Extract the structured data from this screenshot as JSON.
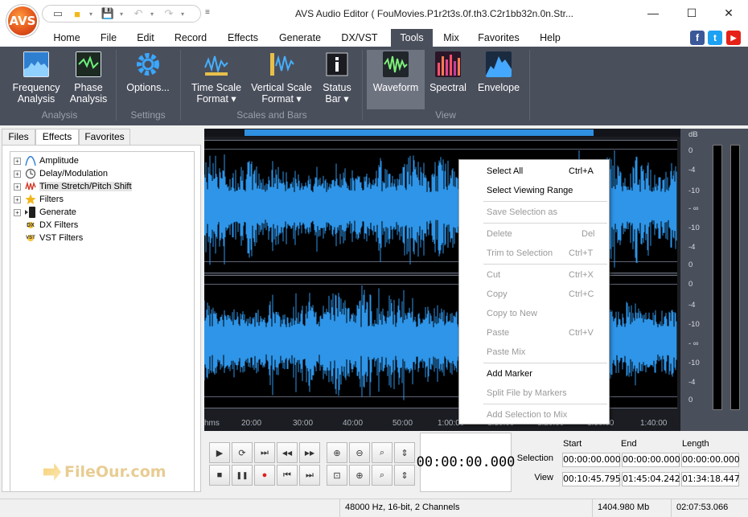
{
  "app": {
    "logo_text": "AVS",
    "window_title": "AVS Audio Editor ( FouMovies.P1r2t3s.0f.th3.C2r1bb32n.0n.Str..."
  },
  "menu": {
    "tabs": [
      "Home",
      "File",
      "Edit",
      "Record",
      "Effects",
      "Generate",
      "DX/VST",
      "Tools",
      "Mix",
      "Favorites",
      "Help"
    ],
    "active": "Tools"
  },
  "social": {
    "facebook": "f",
    "twitter": "t",
    "youtube": "▶"
  },
  "ribbon": {
    "buttons": [
      {
        "line1": "Frequency",
        "line2": "Analysis"
      },
      {
        "line1": "Phase",
        "line2": "Analysis"
      },
      {
        "line1": "Options...",
        "line2": ""
      },
      {
        "line1": "Time Scale",
        "line2": "Format ▾"
      },
      {
        "line1": "Vertical Scale",
        "line2": "Format ▾"
      },
      {
        "line1": "Status",
        "line2": "Bar ▾"
      },
      {
        "line1": "Waveform",
        "line2": ""
      },
      {
        "line1": "Spectral",
        "line2": ""
      },
      {
        "line1": "Envelope",
        "line2": ""
      }
    ],
    "groups": [
      "Analysis",
      "Settings",
      "Scales and Bars",
      "View"
    ],
    "active_view": "Waveform",
    "colors": {
      "bg": "#4a4f5c",
      "accent": "#5ad07a"
    }
  },
  "left_panel": {
    "tabs": [
      "Files",
      "Effects",
      "Favorites"
    ],
    "active_tab": "Effects",
    "tree": [
      {
        "label": "Amplitude",
        "expandable": true,
        "icon": "amplitude-icon"
      },
      {
        "label": "Delay/Modulation",
        "expandable": true,
        "icon": "clock-icon"
      },
      {
        "label": "Time Stretch/Pitch Shift",
        "expandable": true,
        "icon": "pitch-icon",
        "selected": true
      },
      {
        "label": "Filters",
        "expandable": true,
        "icon": "star-icon"
      },
      {
        "label": "Generate",
        "expandable": true,
        "icon": "generate-icon"
      },
      {
        "label": "DX Filters",
        "expandable": false,
        "icon": "dx-icon"
      },
      {
        "label": "VST Filters",
        "expandable": false,
        "icon": "vst-icon"
      }
    ]
  },
  "timeline": {
    "unit": "hms",
    "labels": [
      "20:00",
      "30:00",
      "40:00",
      "50:00",
      "1:00:00",
      "1:10:00",
      "1:20:00",
      "1:30:00",
      "1:40:00"
    ]
  },
  "db_scale": {
    "unit": "dB",
    "channel1": [
      "0",
      "-4",
      "-10",
      "- ∞",
      "-10",
      "-4",
      "0"
    ],
    "channel2": [
      "0",
      "-4",
      "-10",
      "- ∞",
      "-10",
      "-4",
      "0"
    ]
  },
  "waveform": {
    "color": "#2e95e8",
    "background": "#000000"
  },
  "context_menu": [
    {
      "label": "Select All",
      "shortcut": "Ctrl+A",
      "enabled": true
    },
    {
      "label": "Select Viewing Range",
      "shortcut": "",
      "enabled": true
    },
    {
      "separator": true
    },
    {
      "label": "Save Selection as",
      "shortcut": "",
      "enabled": false
    },
    {
      "separator": true
    },
    {
      "label": "Delete",
      "shortcut": "Del",
      "enabled": false
    },
    {
      "label": "Trim to Selection",
      "shortcut": "Ctrl+T",
      "enabled": false
    },
    {
      "separator": true
    },
    {
      "label": "Cut",
      "shortcut": "Ctrl+X",
      "enabled": false
    },
    {
      "label": "Copy",
      "shortcut": "Ctrl+C",
      "enabled": false
    },
    {
      "label": "Copy to New",
      "shortcut": "",
      "enabled": false
    },
    {
      "label": "Paste",
      "shortcut": "Ctrl+V",
      "enabled": false
    },
    {
      "label": "Paste Mix",
      "shortcut": "",
      "enabled": false
    },
    {
      "separator": true
    },
    {
      "label": "Add Marker",
      "shortcut": "",
      "enabled": true
    },
    {
      "label": "Split File by Markers",
      "shortcut": "",
      "enabled": false
    },
    {
      "separator": true
    },
    {
      "label": "Add Selection to Mix",
      "shortcut": "",
      "enabled": false
    }
  ],
  "transport": {
    "row1": [
      "▶",
      "⟳",
      "⏭",
      "◀◀",
      "▶▶"
    ],
    "row2": [
      "■",
      "❚❚",
      "●",
      "⏮",
      "⏭"
    ],
    "zoom_row1": [
      "⊕",
      "⊖",
      "⌕",
      "⇕"
    ],
    "zoom_row2": [
      "⊡",
      "⊕",
      "⌕",
      "⇕"
    ]
  },
  "time_display": "00:00:00.000",
  "selection": {
    "headers": [
      "Start",
      "End",
      "Length"
    ],
    "rows": [
      {
        "label": "Selection",
        "start": "00:00:00.000",
        "end": "00:00:00.000",
        "length": "00:00:00.000"
      },
      {
        "label": "View",
        "start": "00:10:45.795",
        "end": "01:45:04.242",
        "length": "01:34:18.447"
      }
    ]
  },
  "status": {
    "format": "48000 Hz, 16-bit, 2 Channels",
    "size": "1404.980 Mb",
    "duration": "02:07:53.066"
  },
  "watermark": "FileOur.com"
}
